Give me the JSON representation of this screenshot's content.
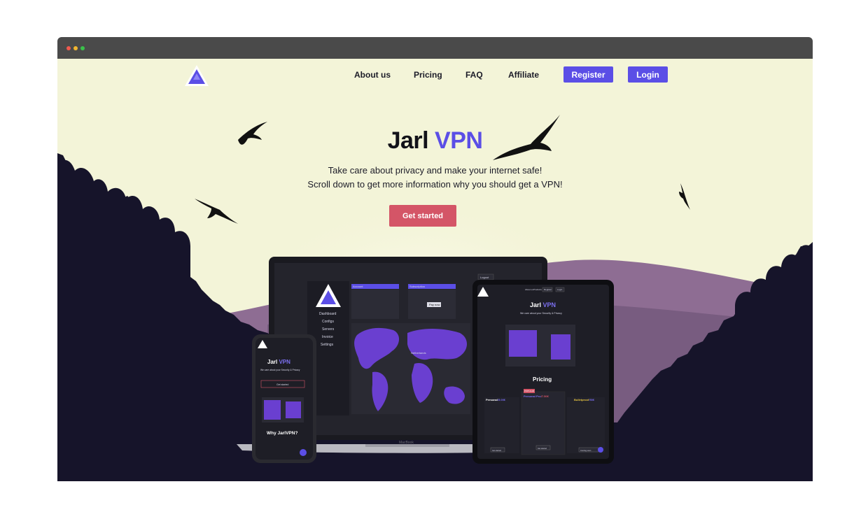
{
  "nav": {
    "links": [
      "About us",
      "Pricing",
      "FAQ",
      "Affiliate"
    ],
    "register_label": "Register",
    "login_label": "Login"
  },
  "hero": {
    "title_plain": "Jarl",
    "title_accent": "VPN",
    "line1": "Take care about privacy and make your internet safe!",
    "line2": "Scroll down to get more information why you should get a VPN!",
    "cta_label": "Get started"
  },
  "mockup": {
    "laptop": {
      "logout": "Logout",
      "menu": [
        "Dashboard",
        "Configs",
        "Servers",
        "Invoice",
        "Settings"
      ],
      "panel_titles": [
        "Account",
        "Subscription"
      ],
      "pay_label": "Pay now",
      "map_label": "Netherlands",
      "brand": "MacBook"
    },
    "phone": {
      "title_plain": "Jarl",
      "title_accent": "VPN",
      "subtitle": "We care about your Security & Privacy",
      "cta": "Get started",
      "section_title": "Why JarlVPN?"
    },
    "tablet": {
      "nav": [
        "About us",
        "Products",
        "Register",
        "Login"
      ],
      "title_plain": "Jarl",
      "title_accent": "VPN",
      "subtitle": "We care about your Security & Privacy",
      "pricing_title": "Pricing",
      "plans": [
        {
          "name": "Personal",
          "price": "/5.00€",
          "button": "Get started"
        },
        {
          "name": "Personal Pro",
          "price": "/7.50€",
          "button": "Get started"
        },
        {
          "name": "Bulletproof",
          "price": "/50€",
          "button": "Coming soon"
        }
      ],
      "badge": "POPULAR"
    }
  },
  "colors": {
    "accent": "#5b4ee6",
    "cta": "#d45567",
    "sky": "#f3f4d8",
    "silhouette": "#16142a"
  },
  "icons": [
    "brand-logo",
    "bird-icon",
    "chat-bubble-icon"
  ]
}
